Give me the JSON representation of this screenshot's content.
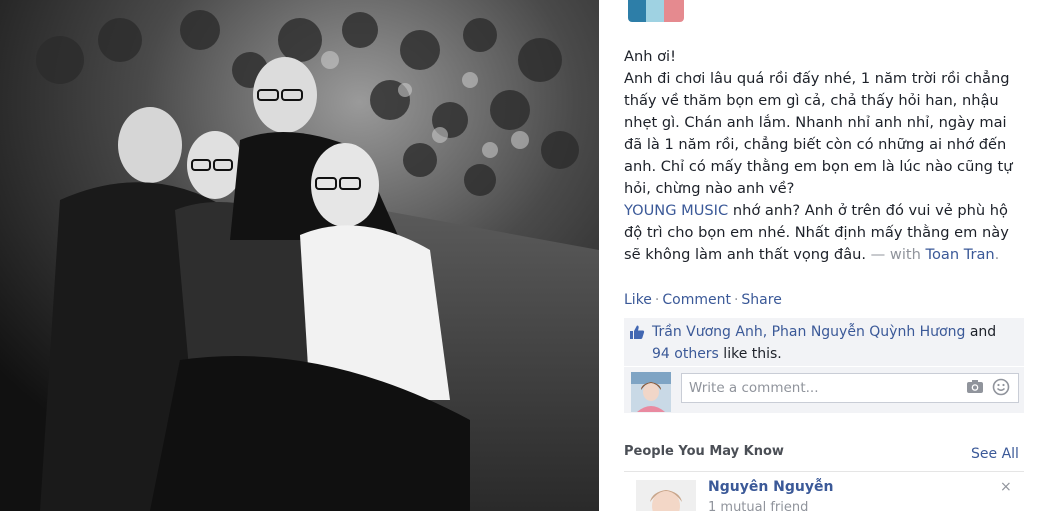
{
  "post": {
    "caption_lines_1": "Anh ơi!\nAnh đi chơi lâu quá rồi đấy nhé, 1 năm trời rồi chẳng thấy về thăm bọn em gì cả, chả thấy hỏi han, nhậu nhẹt gì. Chán anh lắm. Nhanh nhỉ anh nhỉ, ngày mai đã là 1 năm rồi, chẳng biết còn có những ai nhớ đến anh. Chỉ có mấy thằng em bọn em là lúc nào cũng tự hỏi, chừng nào anh về?",
    "page_link": "YOUNG MUSIC",
    "caption_lines_2": " nhớ anh? Anh ở trên đó vui vẻ phù hộ độ trì cho bọn em nhé. Nhất định mấy thằng em này sẽ không làm anh thất vọng đâu.",
    "with_text": " — with ",
    "tagged_person": "Toan Tran",
    "period": "."
  },
  "actions": {
    "like": "Like",
    "comment": "Comment",
    "share": "Share",
    "separator": "·"
  },
  "likes": {
    "people": "Trần Vương Anh, Phan Nguyễn Quỳnh Hương",
    "and": " and",
    "others": "94 others",
    "tail": " like this."
  },
  "comment": {
    "placeholder": "Write a comment..."
  },
  "pymk": {
    "title": "People You May Know",
    "see_all": "See All",
    "name": "Nguyên Nguyễn",
    "mutual": "1 mutual friend",
    "close": "×"
  },
  "icons": {
    "like": "thumbs-up-icon",
    "camera": "camera-icon",
    "emoji": "smiley-icon",
    "close": "close-icon"
  },
  "colors": {
    "link": "#3b5998",
    "muted": "#90949c",
    "panel_bg": "#f2f3f6"
  }
}
